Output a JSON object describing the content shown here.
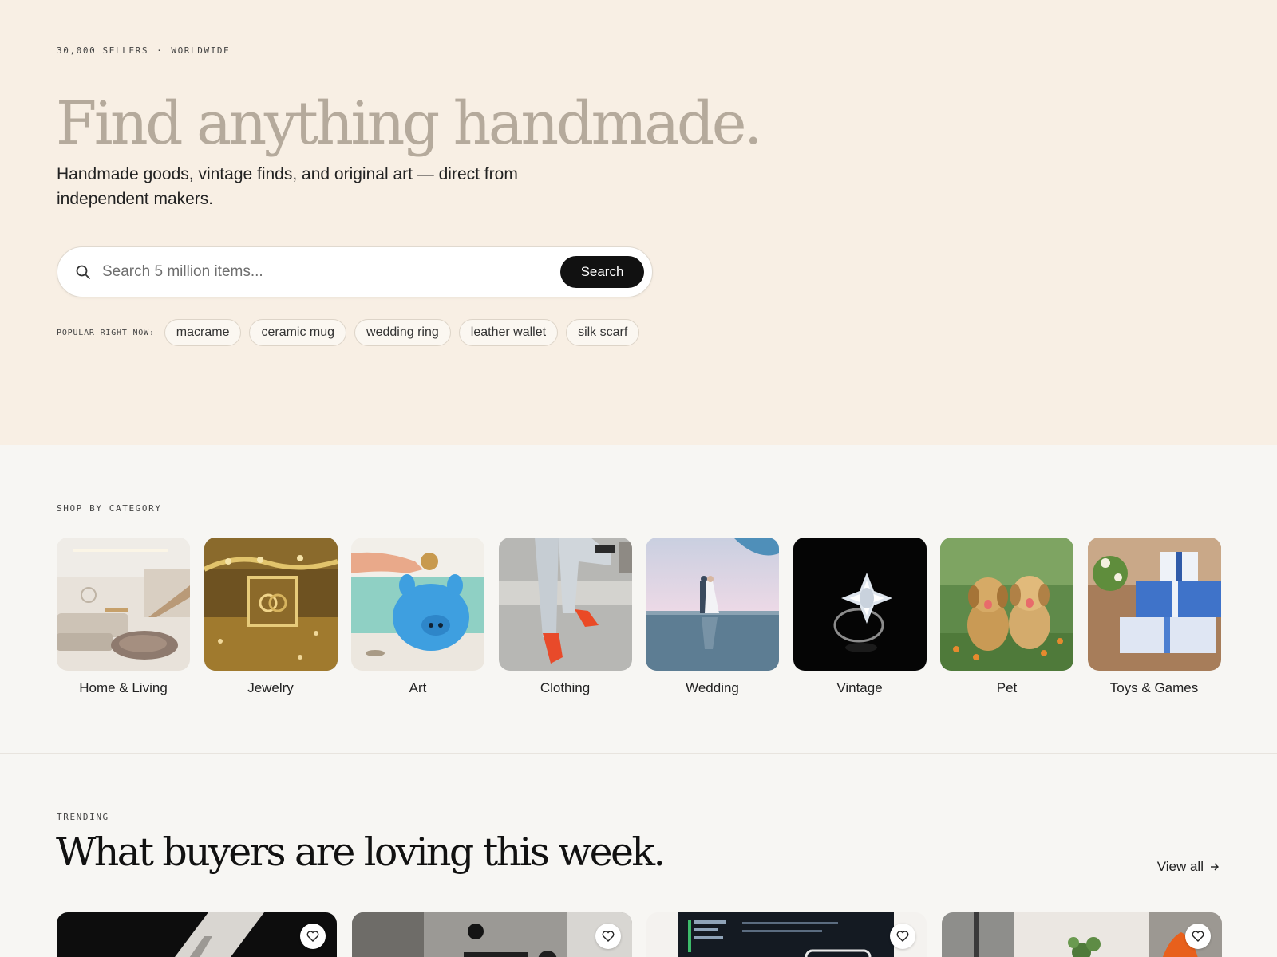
{
  "hero": {
    "eyebrow_sellers": "30,000 SELLERS",
    "eyebrow_separator": "·",
    "eyebrow_region": "WORLDWIDE",
    "title": "Find anything handmade.",
    "subtitle": "Handmade goods, vintage finds, and original art — direct from independent makers.",
    "search": {
      "placeholder": "Search 5 million items...",
      "button_label": "Search",
      "icon": "search-icon"
    },
    "popular": {
      "label": "POPULAR RIGHT NOW:",
      "chips": [
        "macrame",
        "ceramic mug",
        "wedding ring",
        "leather wallet",
        "silk scarf"
      ]
    }
  },
  "categories": {
    "eyebrow": "SHOP BY CATEGORY",
    "items": [
      {
        "label": "Home & Living",
        "image": "living-room"
      },
      {
        "label": "Jewelry",
        "image": "gold-rings"
      },
      {
        "label": "Art",
        "image": "piggy-bank"
      },
      {
        "label": "Clothing",
        "image": "jeans-red-sneakers"
      },
      {
        "label": "Wedding",
        "image": "couple-on-beach"
      },
      {
        "label": "Vintage",
        "image": "diamond-ring"
      },
      {
        "label": "Pet",
        "image": "puppies"
      },
      {
        "label": "Toys & Games",
        "image": "gift-boxes"
      }
    ]
  },
  "trending": {
    "eyebrow": "TRENDING",
    "title": "What buyers are loving this week.",
    "view_all_label": "View all",
    "view_all_icon": "arrow-right-icon",
    "favorite_icon": "heart-icon",
    "products": [
      {
        "image": "dark-product-photo"
      },
      {
        "image": "studio-equipment"
      },
      {
        "image": "trading-screen"
      },
      {
        "image": "window-plant"
      }
    ]
  },
  "colors": {
    "hero_bg": "#f8efe4",
    "page_bg": "#f7f6f3",
    "hero_title": "#b5aa9c",
    "button_bg": "#111111"
  }
}
